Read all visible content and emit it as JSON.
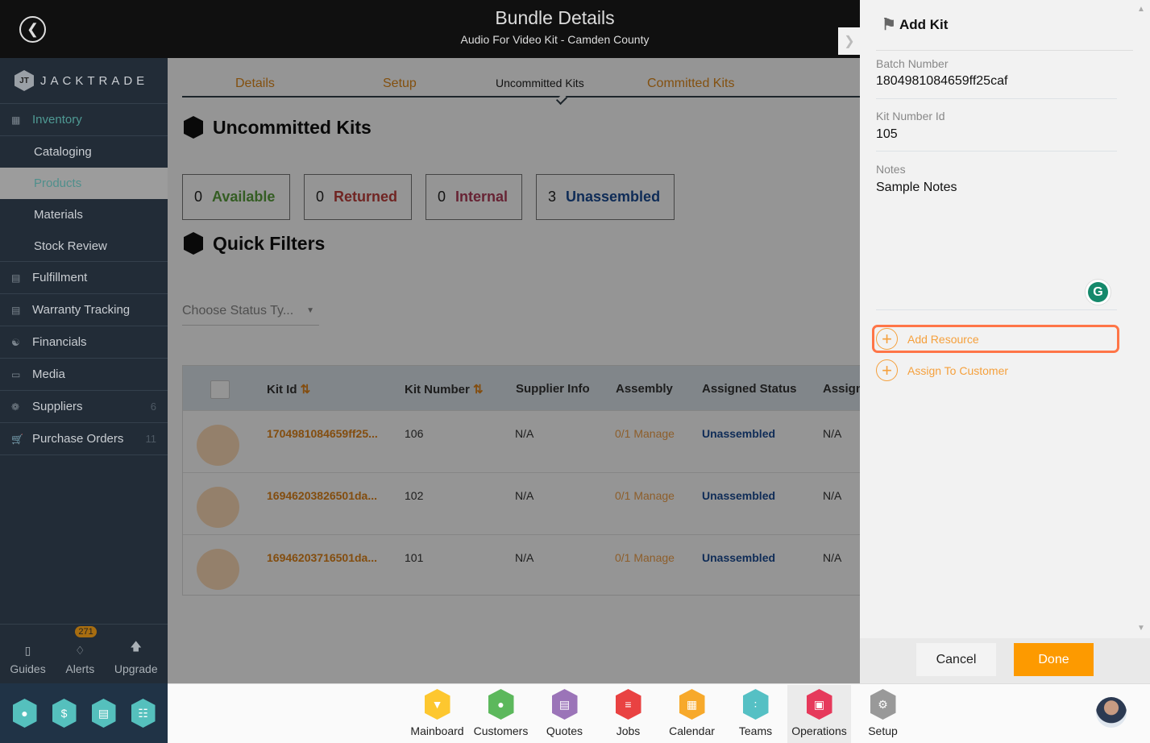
{
  "header": {
    "title": "Bundle Details",
    "subtitle": "Audio For Video Kit - Camden County"
  },
  "sidebar": {
    "brand": "JACKTRADE",
    "items": [
      {
        "label": "Inventory",
        "icon": "inventory-icon"
      },
      {
        "label": "Cataloging"
      },
      {
        "label": "Products",
        "selected": true
      },
      {
        "label": "Materials"
      },
      {
        "label": "Stock Review"
      },
      {
        "label": "Fulfillment",
        "icon": "fulfillment-icon"
      },
      {
        "label": "Warranty Tracking",
        "icon": "warranty-icon"
      },
      {
        "label": "Financials",
        "icon": "financials-icon"
      },
      {
        "label": "Media",
        "icon": "media-icon"
      },
      {
        "label": "Suppliers",
        "icon": "suppliers-icon",
        "count": "6"
      },
      {
        "label": "Purchase Orders",
        "icon": "purchase-orders-icon",
        "count": "11"
      }
    ],
    "footer": {
      "guides": "Guides",
      "alerts": "Alerts",
      "alerts_count": "271",
      "upgrade": "Upgrade"
    }
  },
  "tabs": [
    {
      "label": "Details"
    },
    {
      "label": "Setup"
    },
    {
      "label": "Uncommitted Kits",
      "active": true
    },
    {
      "label": "Committed Kits"
    }
  ],
  "main": {
    "section_title": "Uncommitted Kits",
    "filters_title": "Quick Filters",
    "stats": [
      {
        "count": "0",
        "label": "Available",
        "color": "#5aa03c"
      },
      {
        "count": "0",
        "label": "Returned",
        "color": "#c0403c"
      },
      {
        "count": "0",
        "label": "Internal",
        "color": "#b03c5a"
      },
      {
        "count": "3",
        "label": "Unassembled",
        "color": "#1b4c95"
      }
    ],
    "status_filter": {
      "placeholder": "Choose Status Ty..."
    },
    "table": {
      "columns": [
        "Kit Id",
        "Kit Number",
        "Supplier Info",
        "Assembly",
        "Assigned Status",
        "Assign"
      ],
      "rows": [
        {
          "kit_id": "1704981084659ff25...",
          "kit_number": "106",
          "supplier": "N/A",
          "assembly": "0/1 Manage",
          "status": "Unassembled",
          "assign": "N/A"
        },
        {
          "kit_id": "16946203826501da...",
          "kit_number": "102",
          "supplier": "N/A",
          "assembly": "0/1 Manage",
          "status": "Unassembled",
          "assign": "N/A"
        },
        {
          "kit_id": "16946203716501da...",
          "kit_number": "101",
          "supplier": "N/A",
          "assembly": "0/1 Manage",
          "status": "Unassembled",
          "assign": "N/A"
        }
      ]
    }
  },
  "panel": {
    "title": "Add Kit",
    "fields": [
      {
        "label": "Batch Number",
        "value": "1804981084659ff25caf"
      },
      {
        "label": "Kit Number Id",
        "value": "105"
      },
      {
        "label": "Notes",
        "value": "Sample Notes"
      }
    ],
    "actions": {
      "add_resource": "Add Resource",
      "assign_customer": "Assign To Customer"
    },
    "cancel": "Cancel",
    "done": "Done",
    "accent": "#fd9a00"
  },
  "apps": [
    {
      "label": "Mainboard",
      "color": "#fdc72f",
      "icon": "mainboard-icon"
    },
    {
      "label": "Customers",
      "color": "#5cb85c",
      "icon": "customers-icon"
    },
    {
      "label": "Quotes",
      "color": "#9b74b8",
      "icon": "quotes-icon"
    },
    {
      "label": "Jobs",
      "color": "#e94242",
      "icon": "jobs-icon"
    },
    {
      "label": "Calendar",
      "color": "#f7a92b",
      "icon": "calendar-icon"
    },
    {
      "label": "Teams",
      "color": "#55c0c4",
      "icon": "teams-icon"
    },
    {
      "label": "Operations",
      "color": "#e6395b",
      "icon": "operations-icon",
      "selected": true
    },
    {
      "label": "Setup",
      "color": "#999999",
      "icon": "setup-icon"
    }
  ]
}
